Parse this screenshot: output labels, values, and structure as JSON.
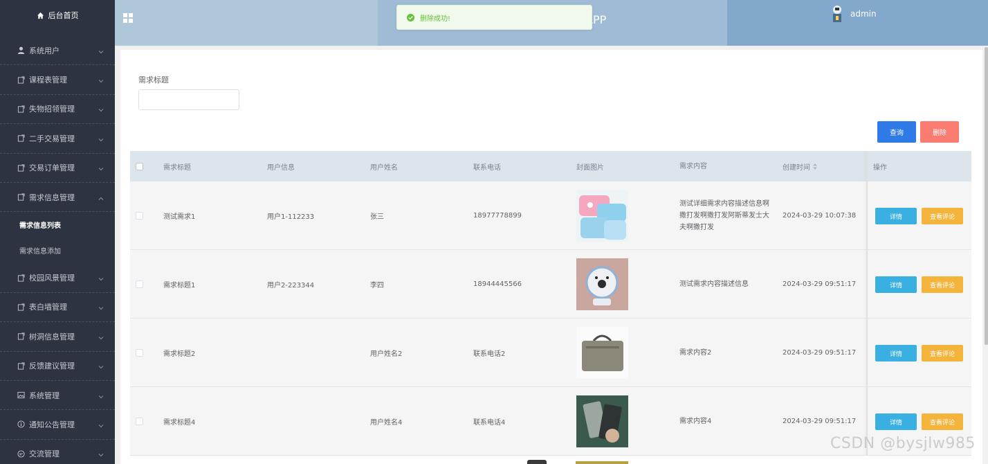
{
  "sidebar": {
    "home": "后台首页",
    "items": [
      {
        "label": "系统用户",
        "icon": "user-icon"
      },
      {
        "label": "课程表管理",
        "icon": "doc-icon"
      },
      {
        "label": "失物招领管理",
        "icon": "doc-icon"
      },
      {
        "label": "二手交易管理",
        "icon": "doc-icon"
      },
      {
        "label": "交易订单管理",
        "icon": "doc-icon"
      },
      {
        "label": "需求信息管理",
        "icon": "doc-icon",
        "expanded": true
      }
    ],
    "sub_items": [
      {
        "label": "需求信息列表",
        "active": true
      },
      {
        "label": "需求信息添加",
        "active": false
      }
    ],
    "items_after": [
      {
        "label": "校园风景管理",
        "icon": "doc-icon"
      },
      {
        "label": "表白墙管理",
        "icon": "doc-icon"
      },
      {
        "label": "树洞信息管理",
        "icon": "doc-icon"
      },
      {
        "label": "反馈建议管理",
        "icon": "doc-icon"
      },
      {
        "label": "系统管理",
        "icon": "picture-icon"
      },
      {
        "label": "通知公告管理",
        "icon": "info-icon"
      },
      {
        "label": "交流管理",
        "icon": "chat-icon"
      }
    ]
  },
  "header": {
    "app_title_fragment": "APP",
    "username": "admin"
  },
  "toast": {
    "message": "删除成功!"
  },
  "search": {
    "label": "需求标题",
    "value": "",
    "query_button": "查询",
    "delete_button": "删除"
  },
  "table": {
    "columns": [
      "需求标题",
      "用户信息",
      "用户姓名",
      "联系电话",
      "封面图片",
      "需求内容",
      "创建时间",
      "操作"
    ],
    "detail_label": "详情",
    "review_label": "查看评论",
    "rows": [
      {
        "title": "测试需求1",
        "user_info": "用户1-112233",
        "user_name": "张三",
        "phone": "18977778899",
        "cover": "pencil-case-image",
        "desc": "测试详细需求内容描述信息啊撒打发啊撒打发阿斯蒂发士大夫啊撒打发",
        "created": "2024-03-29 10:07:38"
      },
      {
        "title": "需求标题1",
        "user_info": "用户2-223344",
        "user_name": "李四",
        "phone": "18944445566",
        "cover": "desk-fan-image",
        "desc": "测试需求内容描述信息",
        "created": "2024-03-29 09:51:17"
      },
      {
        "title": "需求标题2",
        "user_info": "",
        "user_name": "用户姓名2",
        "phone": "联系电话2",
        "cover": "laptop-bag-image",
        "desc": "需求内容2",
        "created": "2024-03-29 09:51:17"
      },
      {
        "title": "需求标题4",
        "user_info": "",
        "user_name": "用户姓名4",
        "phone": "联系电话4",
        "cover": "phone-case-image",
        "desc": "需求内容4",
        "created": "2024-03-29 09:51:17"
      }
    ]
  },
  "watermark": "CSDN @bysjlw985",
  "colors": {
    "sidebar_bg": "#2d3340",
    "header_bg": "#aec7d9",
    "query_btn": "#2e7ae6",
    "delete_btn": "#fa7b6f",
    "detail_btn": "#3ab0e2",
    "review_btn": "#f4b43c"
  }
}
